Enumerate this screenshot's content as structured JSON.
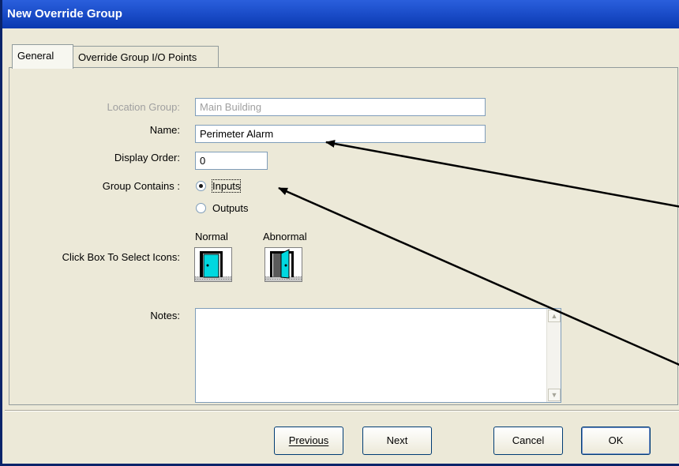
{
  "window": {
    "title": "New Override Group"
  },
  "tabs": [
    {
      "label": "General",
      "active": true
    },
    {
      "label": "Override Group I/O Points",
      "active": false
    }
  ],
  "form": {
    "location_group_label": "Location Group:",
    "location_group_value": "Main Building",
    "name_label": "Name:",
    "name_value": "Perimeter Alarm",
    "display_order_label": "Display Order:",
    "display_order_value": "0",
    "group_contains_label": "Group Contains :",
    "group_contains_options": [
      {
        "label": "Inputs",
        "selected": true
      },
      {
        "label": "Outputs",
        "selected": false
      }
    ],
    "icons_label": "Click Box To Select Icons:",
    "normal_label": "Normal",
    "abnormal_label": "Abnormal",
    "notes_label": "Notes:",
    "notes_value": ""
  },
  "buttons": {
    "previous": "Previous",
    "next": "Next",
    "cancel": "Cancel",
    "ok": "OK"
  },
  "colors": {
    "title_bar": "#1a4cc8",
    "dialog_bg": "#ece9d8",
    "door_fill": "#00d8e0"
  },
  "icons": {
    "normal": "closed-door-icon",
    "abnormal": "open-door-icon"
  }
}
